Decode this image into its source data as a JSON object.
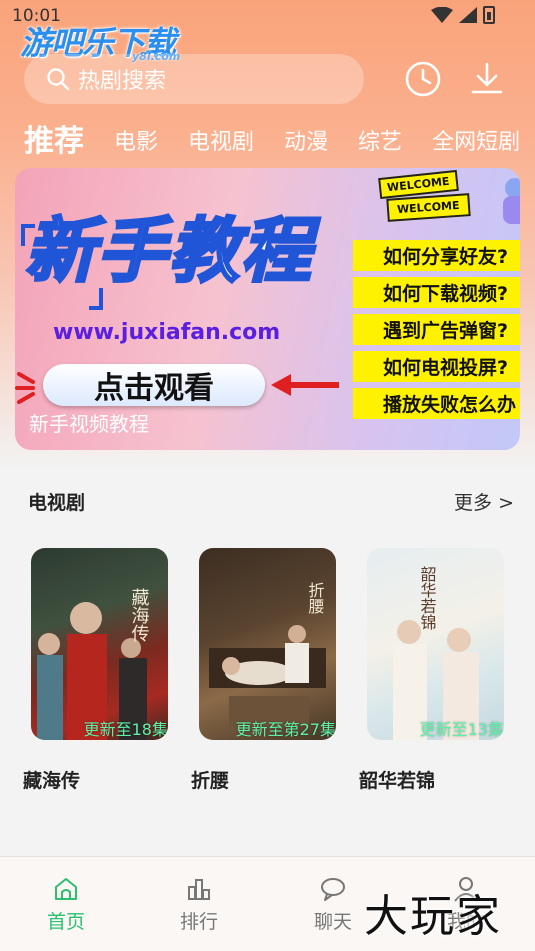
{
  "status_bar": {
    "time": "10:01"
  },
  "header": {
    "logo_text": "游吧乐下载",
    "logo_sub": "y8l.com",
    "search_placeholder": "热剧搜索"
  },
  "tabs": [
    {
      "label": "推荐"
    },
    {
      "label": "电影"
    },
    {
      "label": "电视剧"
    },
    {
      "label": "动漫"
    },
    {
      "label": "综艺"
    },
    {
      "label": "全网短剧"
    }
  ],
  "banner": {
    "title": "新手教程",
    "url": "www.juxiafan.com",
    "cta": "点击观看",
    "caption": "新手视频教程",
    "welcome": "WELCOME",
    "faq": [
      "如何分享好友?",
      "如何下载视频?",
      "遇到广告弹窗?",
      "如何电视投屏?",
      "播放失败怎么办"
    ]
  },
  "section": {
    "title": "电视剧",
    "more": "更多 >"
  },
  "cards": [
    {
      "title": "藏海传",
      "episode": "更新至18集",
      "poster_text": "藏海传"
    },
    {
      "title": "折腰",
      "episode": "更新至第27集",
      "poster_text": "折腰"
    },
    {
      "title": "韶华若锦",
      "episode": "更新至13集",
      "poster_text": "韶华若锦"
    }
  ],
  "bottom_nav": [
    {
      "label": "首页",
      "icon": "home-icon",
      "active": true
    },
    {
      "label": "排行",
      "icon": "ranking-icon",
      "active": false
    },
    {
      "label": "聊天",
      "icon": "chat-icon",
      "active": false
    },
    {
      "label": "我的",
      "icon": "profile-icon",
      "active": false
    }
  ],
  "watermark": "大玩家",
  "colors": {
    "accent_green": "#2bbf6e",
    "banner_blue": "#1f55d6",
    "faq_yellow": "#fff200"
  }
}
